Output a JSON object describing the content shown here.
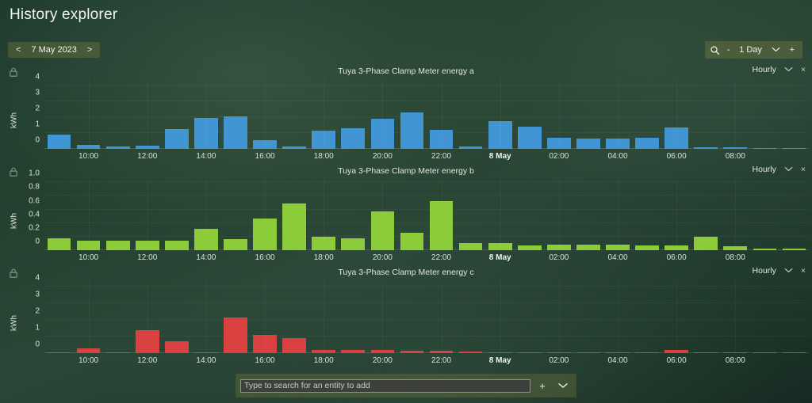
{
  "header": {
    "title": "History explorer",
    "date_picker": {
      "prev_label": "<",
      "date_label": "7 May 2023",
      "next_label": ">"
    },
    "range_picker": {
      "search_icon": "magnifier-icon",
      "minus_label": "-",
      "value": "1 Day",
      "chevron_label": "chevron-down-icon",
      "plus_label": "+"
    }
  },
  "panel_controls": {
    "hourly_label": "Hourly",
    "chevron_label": "⌄",
    "close_label": "×",
    "lock_icon": "lock-icon"
  },
  "entity_search": {
    "placeholder": "Type to search for an entity to add",
    "value": "",
    "add_label": "+",
    "chevron_label": "⌄"
  },
  "colors": {
    "series_a": "#4295d3",
    "series_b": "#8ccc38",
    "series_c": "#d94040",
    "background": "#23402f",
    "accent_panel": "rgba(150,140,70,0.30)"
  },
  "chart_data": [
    {
      "type": "bar",
      "title": "Tuya 3-Phase Clamp Meter energy a",
      "xlabel": "",
      "ylabel": "kWh",
      "ylim": [
        0,
        4.4
      ],
      "yticks": [
        0,
        1,
        2,
        3,
        4
      ],
      "ytick_labels": [
        "0",
        "1",
        "2",
        "3",
        "4"
      ],
      "grid": true,
      "legend": "none",
      "color": "#4295d3",
      "interval": "Hourly",
      "xtick_labels": [
        "10:00",
        "12:00",
        "14:00",
        "16:00",
        "18:00",
        "20:00",
        "22:00",
        "8 May",
        "02:00",
        "04:00",
        "06:00",
        "08:00"
      ],
      "xtick_bold": [
        "8 May"
      ],
      "categories": [
        "09:00",
        "10:00",
        "11:00",
        "12:00",
        "13:00",
        "14:00",
        "15:00",
        "16:00",
        "17:00",
        "18:00",
        "19:00",
        "20:00",
        "21:00",
        "22:00",
        "23:00",
        "00:00",
        "01:00",
        "02:00",
        "03:00",
        "04:00",
        "05:00",
        "06:00",
        "07:00",
        "08:00",
        "09:00",
        "10:00"
      ],
      "values": [
        0.88,
        0.24,
        0.17,
        0.21,
        1.26,
        1.95,
        2.03,
        0.57,
        0.13,
        1.15,
        1.3,
        1.92,
        2.3,
        1.2,
        0.13,
        1.75,
        1.4,
        0.7,
        0.67,
        0.66,
        0.7,
        1.35,
        0.1,
        0.1,
        0.07,
        0.04
      ]
    },
    {
      "type": "bar",
      "title": "Tuya 3-Phase Clamp Meter energy b",
      "xlabel": "",
      "ylabel": "kWh",
      "ylim": [
        0,
        1.05
      ],
      "yticks": [
        0,
        0.2,
        0.4,
        0.6,
        0.8,
        1.0
      ],
      "ytick_labels": [
        "0",
        "0.2",
        "0.4",
        "0.6",
        "0.8",
        "1.0"
      ],
      "grid": true,
      "legend": "none",
      "color": "#8ccc38",
      "interval": "Hourly",
      "xtick_labels": [
        "10:00",
        "12:00",
        "14:00",
        "16:00",
        "18:00",
        "20:00",
        "22:00",
        "8 May",
        "02:00",
        "04:00",
        "06:00",
        "08:00"
      ],
      "xtick_bold": [
        "8 May"
      ],
      "categories": [
        "09:00",
        "10:00",
        "11:00",
        "12:00",
        "13:00",
        "14:00",
        "15:00",
        "16:00",
        "17:00",
        "18:00",
        "19:00",
        "20:00",
        "21:00",
        "22:00",
        "23:00",
        "00:00",
        "01:00",
        "02:00",
        "03:00",
        "04:00",
        "05:00",
        "06:00",
        "07:00",
        "08:00",
        "09:00",
        "10:00"
      ],
      "values": [
        0.18,
        0.14,
        0.14,
        0.14,
        0.14,
        0.32,
        0.16,
        0.47,
        0.69,
        0.2,
        0.17,
        0.57,
        0.26,
        0.72,
        0.1,
        0.11,
        0.07,
        0.08,
        0.08,
        0.08,
        0.07,
        0.07,
        0.2,
        0.06,
        0.02,
        0.02
      ]
    },
    {
      "type": "bar",
      "title": "Tuya 3-Phase Clamp Meter energy c",
      "xlabel": "",
      "ylabel": "kWh",
      "ylim": [
        0,
        4.4
      ],
      "yticks": [
        0,
        1,
        2,
        3,
        4
      ],
      "ytick_labels": [
        "0",
        "1",
        "2",
        "3",
        "4"
      ],
      "grid": true,
      "legend": "none",
      "color": "#d94040",
      "interval": "Hourly",
      "xtick_labels": [
        "10:00",
        "12:00",
        "14:00",
        "16:00",
        "18:00",
        "20:00",
        "22:00",
        "8 May",
        "02:00",
        "04:00",
        "06:00",
        "08:00"
      ],
      "xtick_bold": [
        "8 May"
      ],
      "categories": [
        "09:00",
        "10:00",
        "11:00",
        "12:00",
        "13:00",
        "14:00",
        "15:00",
        "16:00",
        "17:00",
        "18:00",
        "19:00",
        "20:00",
        "21:00",
        "22:00",
        "23:00",
        "00:00",
        "01:00",
        "02:00",
        "03:00",
        "04:00",
        "05:00",
        "06:00",
        "07:00",
        "08:00",
        "09:00",
        "10:00"
      ],
      "values": [
        0.03,
        0.31,
        0.03,
        1.4,
        0.7,
        0.03,
        2.17,
        1.12,
        0.9,
        0.18,
        0.18,
        0.18,
        0.15,
        0.15,
        0.08,
        0.07,
        0.06,
        0.07,
        0.06,
        0.07,
        0.06,
        0.2,
        0.07,
        0.06,
        0.07,
        0.07
      ]
    }
  ]
}
